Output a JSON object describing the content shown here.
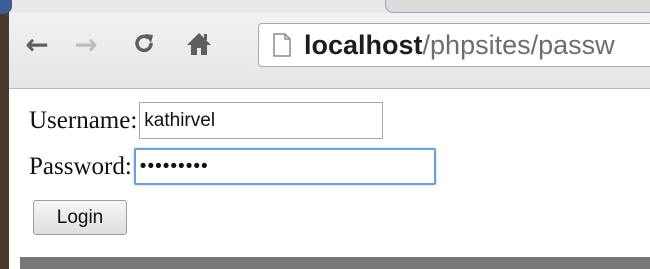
{
  "browser": {
    "nav": {
      "back_icon": "arrow-left-icon",
      "forward_icon": "arrow-right-icon",
      "reload_icon": "reload-icon",
      "home_icon": "home-icon"
    },
    "address": {
      "host": "localhost",
      "path": "/phpsites/passw"
    }
  },
  "form": {
    "username_label": "Username:",
    "username_value": "kathirvel",
    "password_label": "Password:",
    "password_value": "•••••••••",
    "login_label": "Login"
  },
  "colors": {
    "focus_border": "#6d9fd8",
    "url_host": "#1d1d1d",
    "url_path": "#6d6d6d"
  }
}
